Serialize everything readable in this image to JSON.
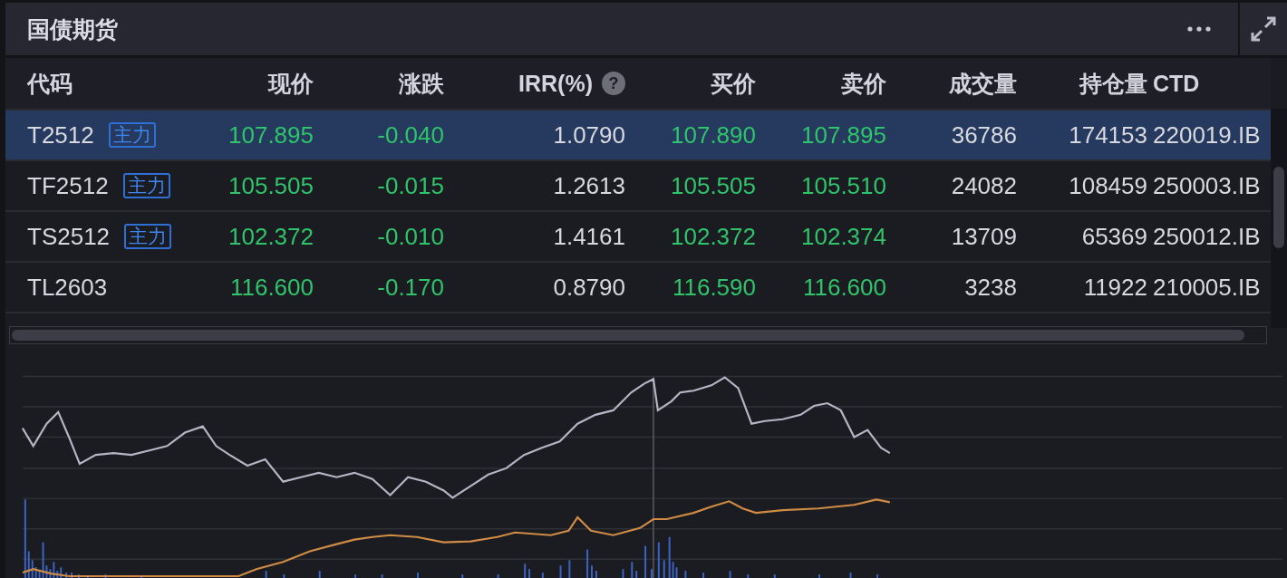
{
  "panel": {
    "title": "国债期货"
  },
  "table": {
    "columns": [
      {
        "label": "代码"
      },
      {
        "label": "现价"
      },
      {
        "label": "涨跌"
      },
      {
        "label": "IRR(%)",
        "help": "?"
      },
      {
        "label": "买价"
      },
      {
        "label": "卖价"
      },
      {
        "label": "成交量"
      },
      {
        "label": "持仓量"
      },
      {
        "label": "CTD"
      }
    ],
    "rows": [
      {
        "selected": true,
        "color": "#2fc46b",
        "code": "T2512",
        "badge": "主力",
        "price": "107.895",
        "change": "-0.040",
        "irr": "1.0790",
        "bid": "107.890",
        "ask": "107.895",
        "volume": "36786",
        "open_interest": "174153",
        "ctd": "220019.IB"
      },
      {
        "selected": false,
        "color": "#2fc46b",
        "code": "TF2512",
        "badge": "主力",
        "price": "105.505",
        "change": "-0.015",
        "irr": "1.2613",
        "bid": "105.505",
        "ask": "105.510",
        "volume": "24082",
        "open_interest": "108459",
        "ctd": "250003.IB"
      },
      {
        "selected": false,
        "color": "#2fc46b",
        "code": "TS2512",
        "badge": "主力",
        "price": "102.372",
        "change": "-0.010",
        "irr": "1.4161",
        "bid": "102.372",
        "ask": "102.374",
        "volume": "13709",
        "open_interest": "65369",
        "ctd": "250012.IB"
      },
      {
        "selected": false,
        "color": "#2fc46b",
        "code": "TL2603",
        "price": "116.600",
        "change": "-0.170",
        "irr": "0.8790",
        "bid": "116.590",
        "ask": "116.600",
        "volume": "3238",
        "open_interest": "11922",
        "ctd": "210005.IB"
      }
    ]
  }
}
